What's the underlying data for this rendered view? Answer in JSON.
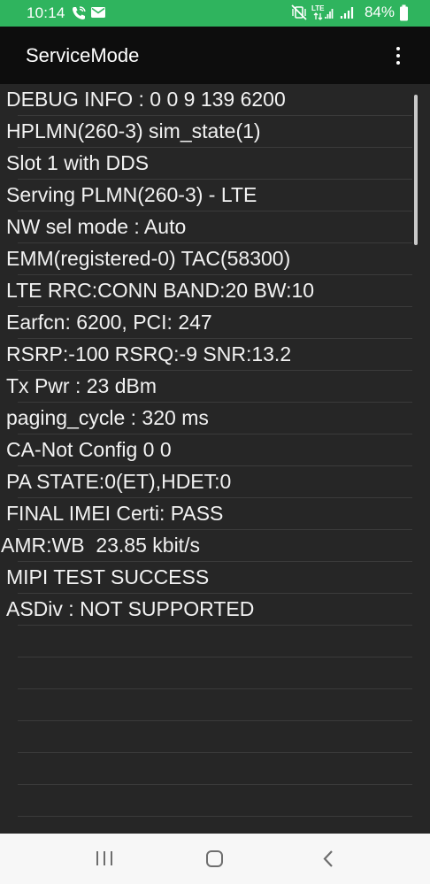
{
  "status_bar": {
    "time": "10:14",
    "battery_percent": "84%",
    "network_type": "LTE",
    "left_icons": [
      "wifi-calling-icon",
      "mail-icon"
    ],
    "right_icons": [
      "mute-vibrate-icon",
      "lte-signal-icon",
      "signal-icon",
      "battery-icon"
    ],
    "background_color": "#2fb45e"
  },
  "app_bar": {
    "title": "ServiceMode",
    "menu_icon": "more-vert-icon"
  },
  "info_rows": [
    "DEBUG INFO : 0 0 9 139 6200",
    "HPLMN(260-3) sim_state(1)",
    "Slot 1 with DDS",
    "Serving PLMN(260-3) - LTE",
    "NW sel mode : Auto",
    "EMM(registered-0) TAC(58300)",
    "LTE RRC:CONN BAND:20 BW:10",
    "Earfcn: 6200, PCI: 247",
    "RSRP:-100 RSRQ:-9 SNR:13.2",
    "Tx Pwr : 23 dBm",
    "paging_cycle : 320 ms",
    "CA-Not Config 0 0",
    "PA STATE:0(ET),HDET:0",
    "FINAL IMEI Certi: PASS",
    "AMR:WB  23.85 kbit/s",
    "MIPI TEST SUCCESS",
    "ASDiv : NOT SUPPORTED"
  ],
  "nav_bar": {
    "recents_icon": "recents-icon",
    "home_icon": "home-icon",
    "back_icon": "back-icon"
  }
}
